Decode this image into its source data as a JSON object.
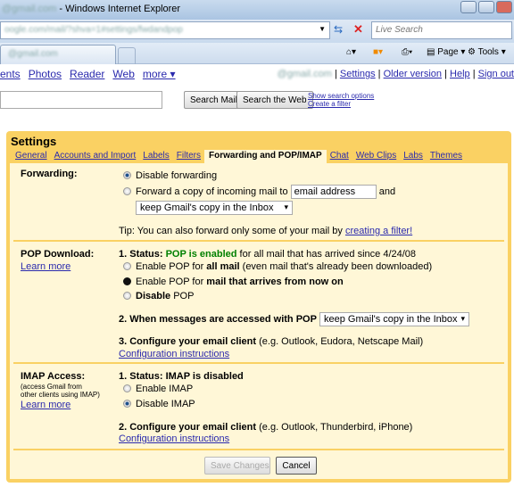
{
  "browser": {
    "title_blurred": "@gmail.com",
    "title": " - Windows Internet Explorer",
    "url": "oogle.com/mail/?shva=1#settings/fwdandpop",
    "live_search_placeholder": "Live Search",
    "tab_title_blurred": "@gmail.com",
    "page_menu": "Page",
    "tools_menu": "Tools"
  },
  "gmail_nav": {
    "links": [
      "ents",
      "Photos",
      "Reader",
      "Web",
      "more ▾"
    ],
    "account_blurred": "@gmail.com",
    "account_links": [
      "Settings",
      "Older version",
      "Help",
      "Sign out"
    ]
  },
  "search": {
    "search_mail": "Search Mail",
    "search_web": "Search the Web",
    "show_options": "Show search options",
    "create_filter": "Create a filter"
  },
  "settings": {
    "title": "Settings",
    "tabs": [
      "General",
      "Accounts and Import",
      "Labels",
      "Filters",
      "Forwarding and POP/IMAP",
      "Chat",
      "Web Clips",
      "Labs",
      "Themes"
    ],
    "active_tab": "Forwarding and POP/IMAP",
    "forwarding": {
      "label": "Forwarding:",
      "disable": "Disable forwarding",
      "forward_copy": "Forward a copy of incoming mail to",
      "email_placeholder": "email address",
      "and": "and",
      "keep_select": "keep Gmail's copy in the Inbox",
      "tip": "Tip: You can also forward only some of your mail by",
      "tip_link": "creating a filter!",
      "selected": "disable"
    },
    "pop": {
      "label": "POP Download:",
      "learn_more": "Learn more",
      "status_prefix": "1. Status:",
      "status_value": "POP is enabled",
      "status_suffix": "for all mail that has arrived since 4/24/08",
      "opt1_a": "Enable POP for",
      "opt1_b": "all mail",
      "opt1_c": "(even mail that's already been downloaded)",
      "opt2_a": "Enable POP for",
      "opt2_b": "mail that arrives from now on",
      "opt3_a": "Disable",
      "opt3_b": "POP",
      "step2": "2. When messages are accessed with POP",
      "step2_select": "keep Gmail's copy in the Inbox",
      "step3": "3. Configure your email client",
      "step3_eg": "(e.g. Outlook, Eudora, Netscape Mail)",
      "config_link": "Configuration instructions",
      "selected": "from-now-on",
      "status_color": "#008000"
    },
    "imap": {
      "label": "IMAP Access:",
      "sublabel1": "(access Gmail from",
      "sublabel2": "other clients using IMAP)",
      "learn_more": "Learn more",
      "status": "1. Status: IMAP is disabled",
      "enable": "Enable IMAP",
      "disable": "Disable IMAP",
      "step2": "2. Configure your email client",
      "step2_eg": "(e.g. Outlook, Thunderbird, iPhone)",
      "config_link": "Configuration instructions",
      "selected": "disable"
    },
    "save": "Save Changes",
    "cancel": "Cancel"
  }
}
